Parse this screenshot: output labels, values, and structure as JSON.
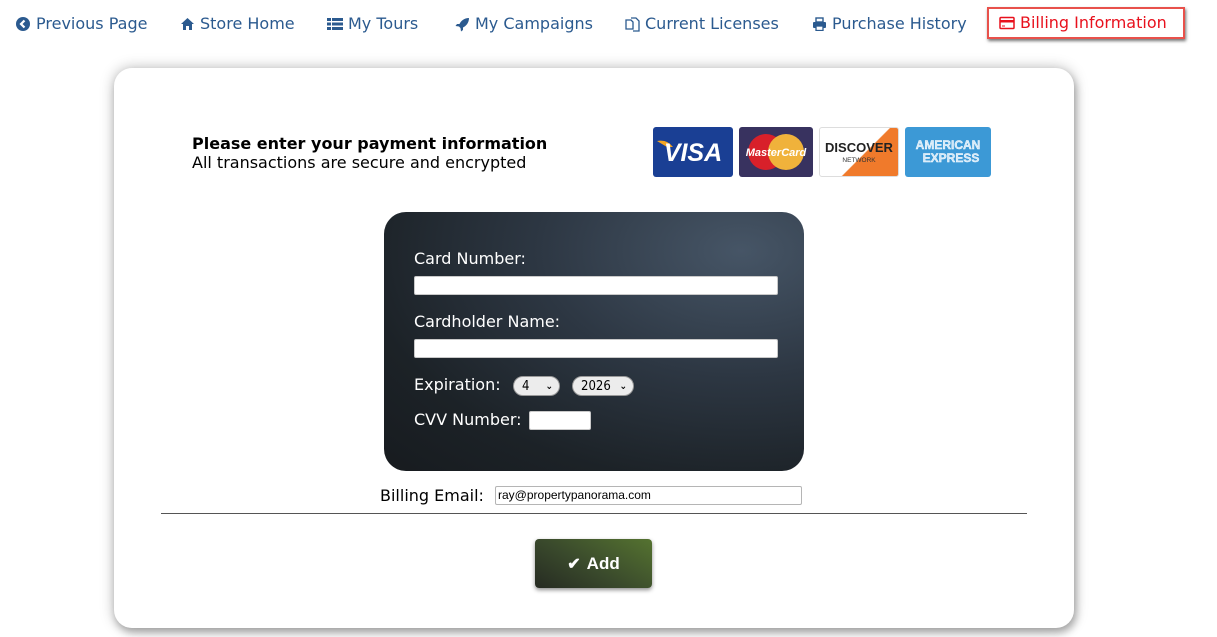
{
  "nav": {
    "items": [
      {
        "label": "Previous Page",
        "icon": "arrow-circle-left-icon"
      },
      {
        "label": "Store Home",
        "icon": "home-icon"
      },
      {
        "label": "My Tours",
        "icon": "list-icon"
      },
      {
        "label": "My Campaigns",
        "icon": "rocket-icon"
      },
      {
        "label": "Current Licenses",
        "icon": "copy-icon"
      },
      {
        "label": "Purchase History",
        "icon": "print-icon"
      },
      {
        "label": "Billing Information",
        "icon": "credit-card-icon",
        "active": true
      }
    ],
    "link_color": "#2b5a8f",
    "active_color": "#e8111d"
  },
  "intro": {
    "title": "Please enter your payment information",
    "subtitle": "All transactions are secure and encrypted"
  },
  "card_logos": [
    {
      "name": "VISA"
    },
    {
      "name": "MasterCard"
    },
    {
      "name": "DISCOVER",
      "sub": "NETWORK"
    },
    {
      "name": "AMERICAN",
      "sub": "EXPRESS"
    }
  ],
  "form": {
    "card_number_label": "Card Number:",
    "card_number_value": "",
    "cardholder_label": "Cardholder Name:",
    "cardholder_value": "",
    "expiration_label": "Expiration:",
    "exp_month": "4",
    "exp_year": "2026",
    "cvv_label": "CVV Number:",
    "cvv_value": "",
    "billing_email_label": "Billing Email:",
    "billing_email_value": "ray@propertypanorama.com"
  },
  "actions": {
    "add_label": "Add",
    "add_icon": "check-icon"
  }
}
